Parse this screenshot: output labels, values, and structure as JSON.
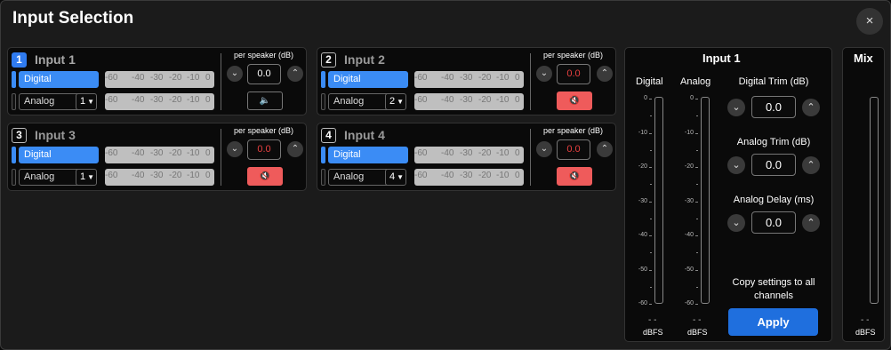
{
  "title": "Input Selection",
  "close_icon": "×",
  "per_speaker_label": "per speaker (dB)",
  "meter_ticks": [
    "-60",
    "-40",
    "-30",
    "-20",
    "-10",
    "0"
  ],
  "inputs": [
    {
      "num": "1",
      "name": "Input 1",
      "digital_label": "Digital",
      "analog_label": "Analog",
      "channel": "1",
      "trim": "0.0",
      "muted": false
    },
    {
      "num": "2",
      "name": "Input 2",
      "digital_label": "Digital",
      "analog_label": "Analog",
      "channel": "2",
      "trim": "0.0",
      "muted": true
    },
    {
      "num": "3",
      "name": "Input 3",
      "digital_label": "Digital",
      "analog_label": "Analog",
      "channel": "1",
      "trim": "0.0",
      "muted": true
    },
    {
      "num": "4",
      "name": "Input 4",
      "digital_label": "Digital",
      "analog_label": "Analog",
      "channel": "4",
      "trim": "0.0",
      "muted": true
    }
  ],
  "detail": {
    "title": "Input 1",
    "digital_meter_label": "Digital",
    "analog_meter_label": "Analog",
    "digital_trim_label": "Digital Trim (dB)",
    "digital_trim_value": "0.0",
    "analog_trim_label": "Analog Trim (dB)",
    "analog_trim_value": "0.0",
    "analog_delay_label": "Analog Delay (ms)",
    "analog_delay_value": "0.0",
    "copy_text": "Copy settings to all channels",
    "apply_label": "Apply"
  },
  "mix": {
    "title": "Mix"
  },
  "vmeter_ticks": [
    "0",
    "-10",
    "-20",
    "-30",
    "-40",
    "-50",
    "-60"
  ],
  "meter_readout": "- -",
  "meter_unit": "dBFS",
  "colors": {
    "accent": "#3b8cf5",
    "mute_active": "#ef5b5b",
    "apply": "#1f6fde"
  }
}
